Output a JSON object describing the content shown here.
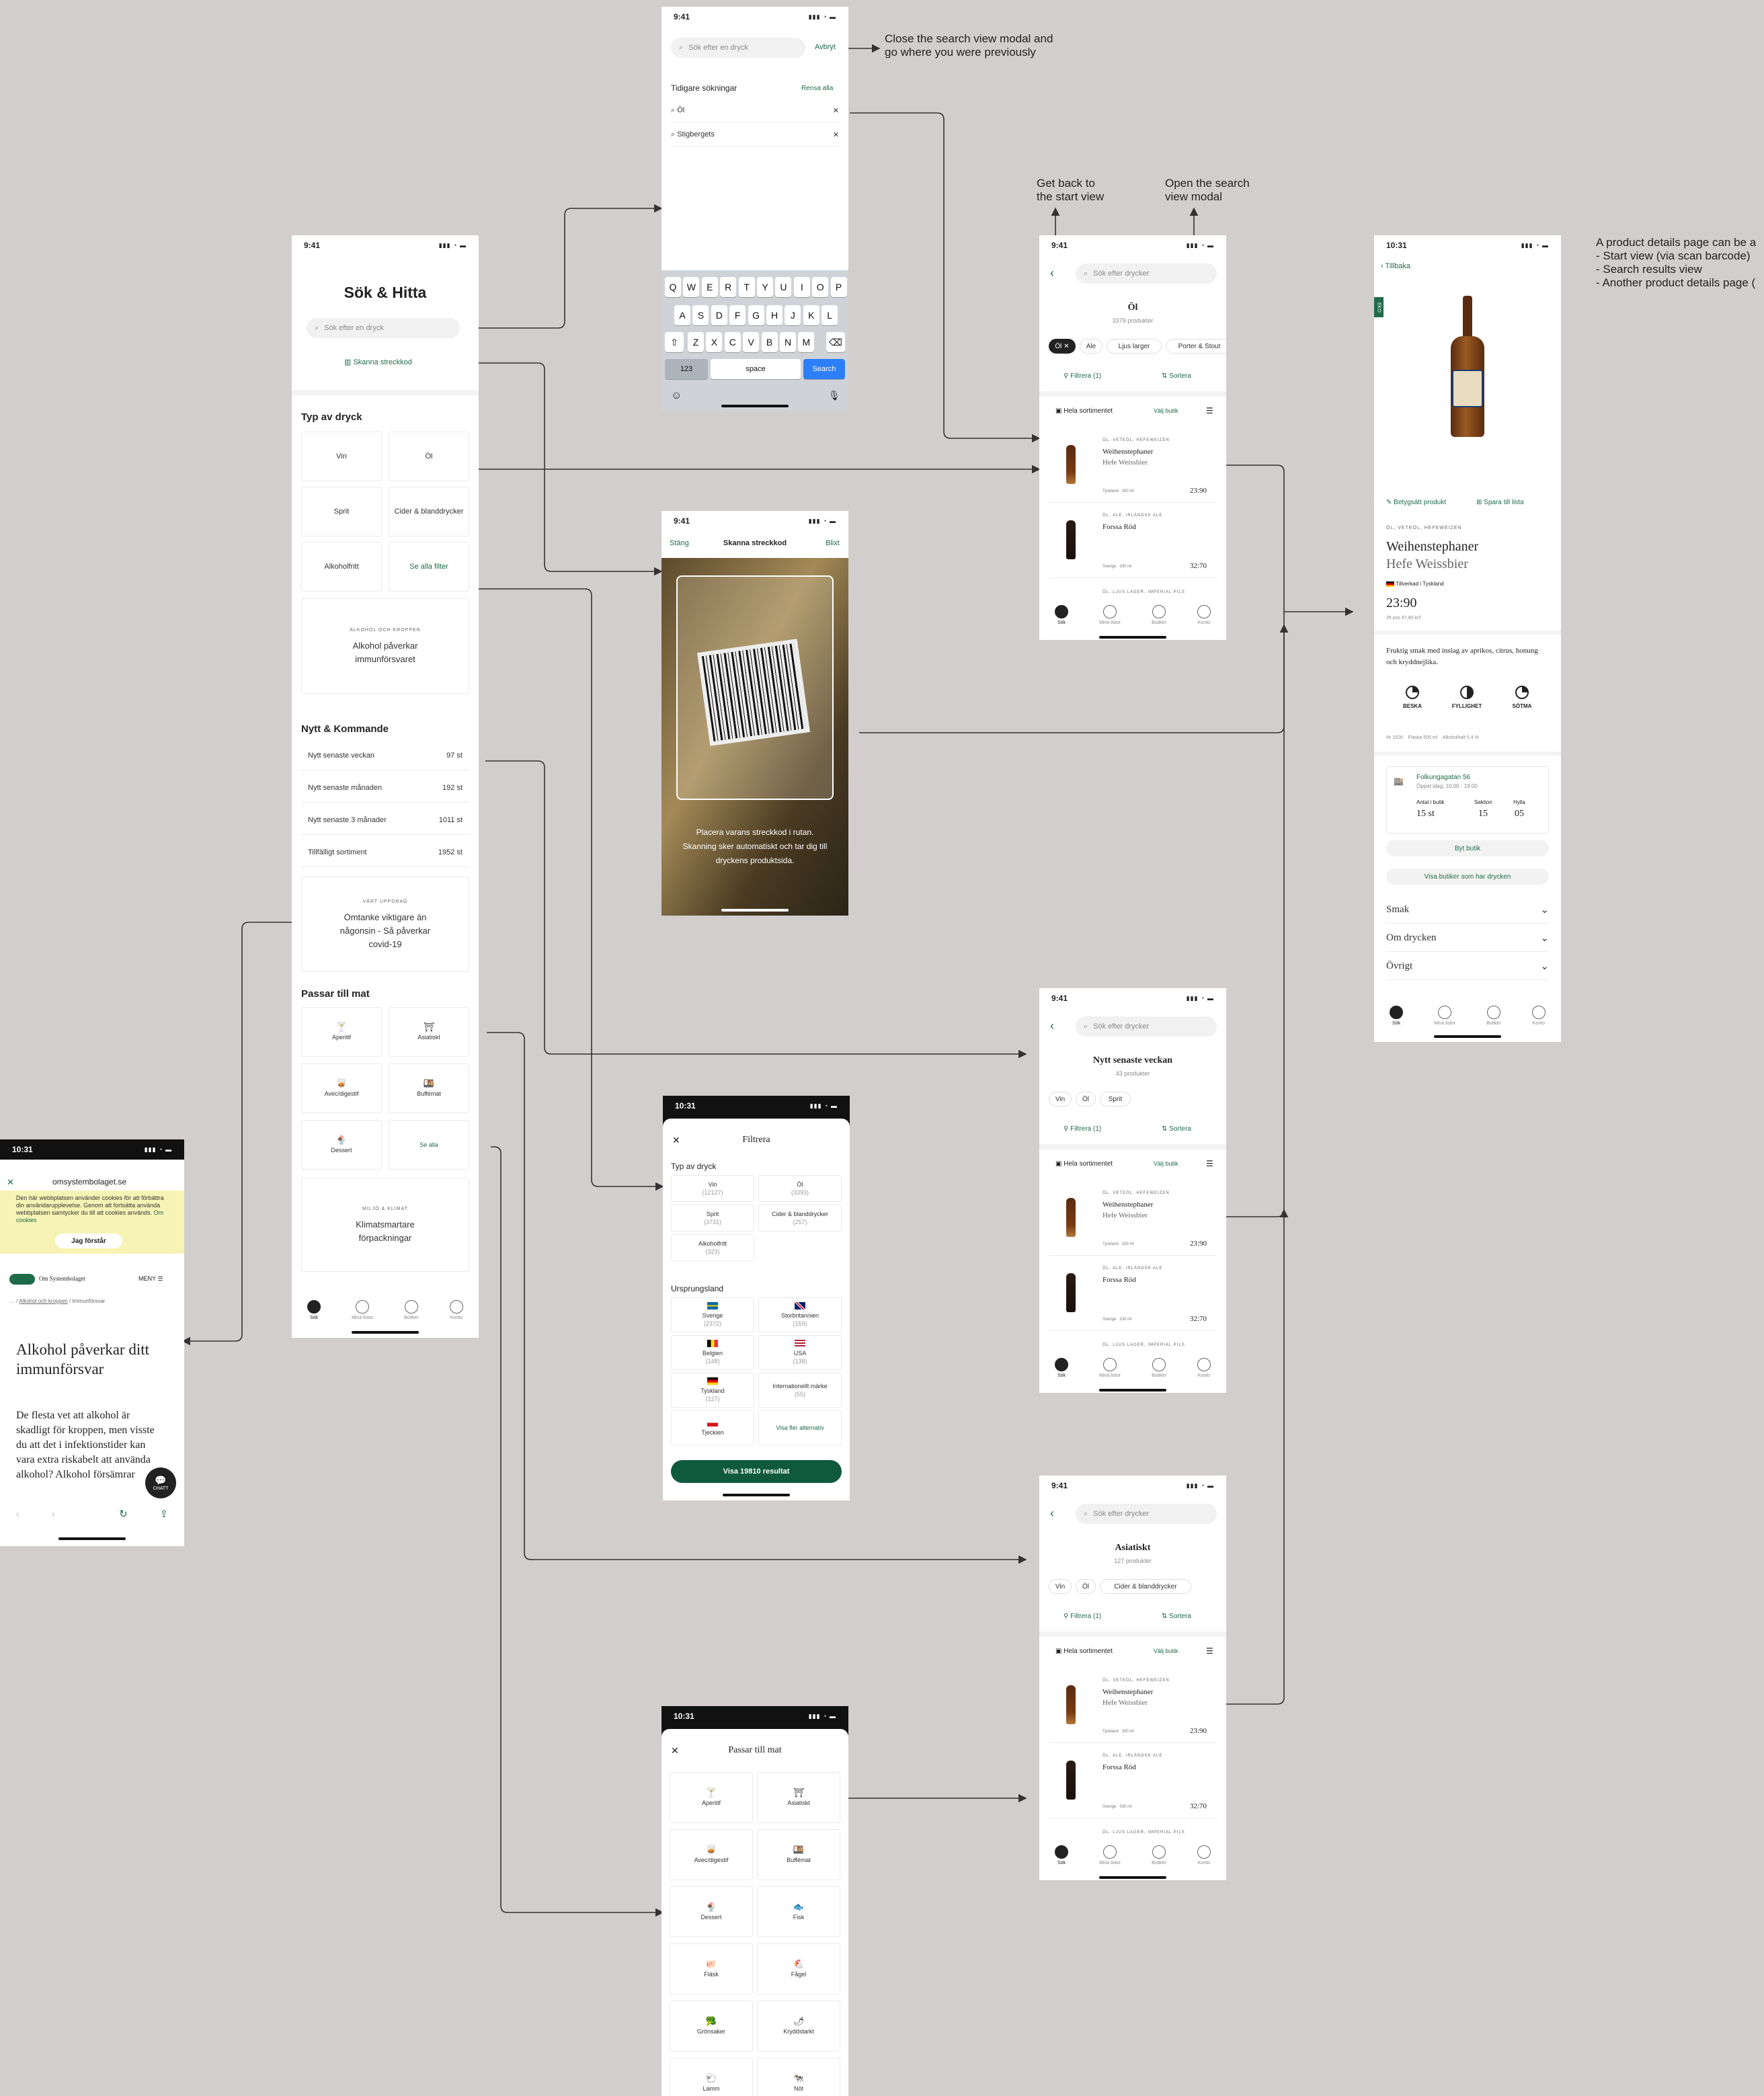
{
  "status_time_a": "9:41",
  "status_time_b": "10:31",
  "notes": {
    "close_search": "Close the search view modal and\ngo where you were previously",
    "get_back": "Get back to\nthe start view",
    "open_search": "Open the search\nview modal",
    "product_details": "A product details page can be a\n- Start view (via scan barcode)\n- Search results view\n- Another product details page ("
  },
  "start": {
    "title": "Sök & Hitta",
    "search_placeholder": "Sök efter en dryck",
    "scan_label": "Skanna streckkod",
    "type_heading": "Typ av dryck",
    "types": [
      "Vin",
      "Öl",
      "Sprit",
      "Cider & blanddrycker",
      "Alkoholfritt",
      "Se alla filter"
    ],
    "promo1_label": "ALKOHOL OCH KROPPEN",
    "promo1_title": "Alkohol påverkar immunförsvaret",
    "new_heading": "Nytt & Kommande",
    "new_rows": [
      {
        "label": "Nytt senaste veckan",
        "count": "97 st"
      },
      {
        "label": "Nytt senaste månaden",
        "count": "192 st"
      },
      {
        "label": "Nytt senaste 3 månader",
        "count": "1011 st"
      },
      {
        "label": "Tillfälligt sortiment",
        "count": "1952 st"
      }
    ],
    "promo2_label": "VÅRT UPPDRAG",
    "promo2_title": "Omtanke viktigare än någonsin - Så påverkar covid-19",
    "food_heading": "Passar till mat",
    "food": [
      "Aperitif",
      "Asiatiskt",
      "Avec/digestif",
      "Buffémat",
      "Dessert",
      "Se alla"
    ],
    "promo3_label": "MILJÖ & KLIMAT",
    "promo3_title": "Klimatsmartare förpackningar"
  },
  "tabs": [
    "Sök",
    "Mina listor",
    "Butiker",
    "Konto"
  ],
  "search_modal": {
    "placeholder": "Sök efter en dryck",
    "cancel": "Avbryt",
    "recent_heading": "Tidigare sökningar",
    "clear_all": "Rensa alla",
    "recent": [
      "Öl",
      "Stigbergets"
    ],
    "keys_row1": [
      "Q",
      "W",
      "E",
      "R",
      "T",
      "Y",
      "U",
      "I",
      "O",
      "P"
    ],
    "keys_row2": [
      "A",
      "S",
      "D",
      "F",
      "G",
      "H",
      "J",
      "K",
      "L"
    ],
    "keys_row3": [
      "Z",
      "X",
      "C",
      "V",
      "B",
      "N",
      "M"
    ],
    "key_123": "123",
    "key_space": "space",
    "key_search": "Search"
  },
  "scan": {
    "close": "Stäng",
    "title": "Skanna streckkod",
    "flash": "Blixt",
    "instruction": "Placera varans streckkod i rutan. Skanning sker automatiskt och tar dig till dryckens produktsida."
  },
  "results_search_placeholder": "Sök efter drycker",
  "filter_label": "Filtrera (1)",
  "sort_label": "Sortera",
  "assortment_label": "Hela sortimentet",
  "store_select": "Välj butik",
  "products": [
    {
      "meta": "ÖL, VETEÖL, HEFEWEIZEN",
      "name": "Weihenstephaner",
      "sub": "Hefe Weissbier",
      "origin": "Tyskland",
      "vol": "330 ml",
      "price": "23:90"
    },
    {
      "meta": "ÖL, ALE, IRLÄNDSK ALE",
      "name": "Forssa Röd",
      "sub": "",
      "origin": "Sverige",
      "vol": "330 ml",
      "price": "32:70"
    },
    {
      "meta": "ÖL, LJUS LAGER, IMPERIAL PILS"
    }
  ],
  "results_ol": {
    "title": "Öl",
    "count": "3379 produkter",
    "chips": [
      "Öl ✕",
      "Ale",
      "Ljus larger",
      "Porter & Stout"
    ]
  },
  "results_new": {
    "title": "Nytt senaste veckan",
    "count": "43 produkter",
    "chips": [
      "Vin",
      "Öl",
      "Sprit"
    ]
  },
  "results_asian": {
    "title": "Asiatiskt",
    "count": "127 produkter",
    "chips": [
      "Vin",
      "Öl",
      "Cider & blanddrycker"
    ]
  },
  "details": {
    "back": "Tillbaka",
    "rate": "Betygsätt produkt",
    "save": "Spara till lista",
    "meta": "ÖL, VETEÖL, HEFEWEIZEN",
    "name": "Weihenstephaner",
    "sub": "Hefe Weissbier",
    "origin": "Tillverkad i Tyskland",
    "price": "23:90",
    "unit_price": "Jfr pris 87,80 kr/l",
    "description": "Fruktig smak med inslag av aprikos, citrus, honung och kryddnejlika.",
    "taste": [
      "BESKA",
      "FYLLIGHET",
      "SÖTMA"
    ],
    "specs": "Nr 1526    Flaska 500 ml    Alkoholhalt 5,4 %",
    "store_name": "Folkungagatan 56",
    "store_hours": "Öppet idag: 10:00 - 19:00",
    "stock_labels": [
      "Antal i butik",
      "Sektion",
      "Hylla"
    ],
    "stock_values": [
      "15 st",
      "15",
      "05"
    ],
    "change_store": "Byt butik",
    "show_stores": "Visa butiker som har drycken",
    "accordions": [
      "Smak",
      "Om drycken",
      "Övrigt"
    ],
    "eco": "EKO"
  },
  "filter_modal": {
    "title": "Filtrera",
    "type_heading": "Typ av dryck",
    "types": [
      {
        "name": "Vin",
        "count": "(12127)"
      },
      {
        "name": "Öl",
        "count": "(3393)"
      },
      {
        "name": "Sprit",
        "count": "(3731)"
      },
      {
        "name": "Cider & blanddrycker",
        "count": "(257)"
      },
      {
        "name": "Alkoholfritt",
        "count": "(323)"
      }
    ],
    "origin_heading": "Ursprungsland",
    "origins": [
      {
        "name": "Sverige",
        "count": "(2372)"
      },
      {
        "name": "Storbritannien",
        "count": "(159)"
      },
      {
        "name": "Belgien",
        "count": "(148)"
      },
      {
        "name": "USA",
        "count": "(138)"
      },
      {
        "name": "Tyskland",
        "count": "(127)"
      },
      {
        "name": "Internationellt märke",
        "count": "(55)"
      },
      {
        "name": "Tjeckien",
        "count": ""
      },
      {
        "name": "Visa fler alternativ",
        "count": ""
      }
    ],
    "show_results": "Visa 19810 resultat"
  },
  "food_modal": {
    "title": "Passar till mat",
    "items": [
      "Aperitif",
      "Asiatiskt",
      "Avec/digestif",
      "Buffémat",
      "Dessert",
      "Fisk",
      "Fläsk",
      "Fågel",
      "Grönsaker",
      "Kryddstarkt",
      "Lamm",
      "Nöt"
    ]
  },
  "web": {
    "url": "omsystembolaget.se",
    "cookie_text": "Den här webbplatsen använder cookies för att förbättra din användarupplevelse. Genom att fortsätta använda webbplatsen samtycker du till att cookies används.",
    "cookie_link": "Om cookies",
    "cookie_button": "Jag förstår",
    "brand": "Om Systembolaget",
    "menu": "MENY",
    "breadcrumb_a": "Alkohol och kroppen",
    "breadcrumb_b": "Immunförsvar",
    "headline": "Alkohol påverkar ditt immunförsvar",
    "body": "De flesta vet att alkohol är skadligt för kroppen, men visste du att det i infektionstider kan vara extra riskabelt att använda alkohol? Alkohol försämrar",
    "chat": "CHATT"
  },
  "colors": {
    "background": "#d2cecd",
    "accent": "#1e6b48",
    "ios_blue": "#2d7ff9",
    "cookie_bg": "#f7f3b5"
  }
}
